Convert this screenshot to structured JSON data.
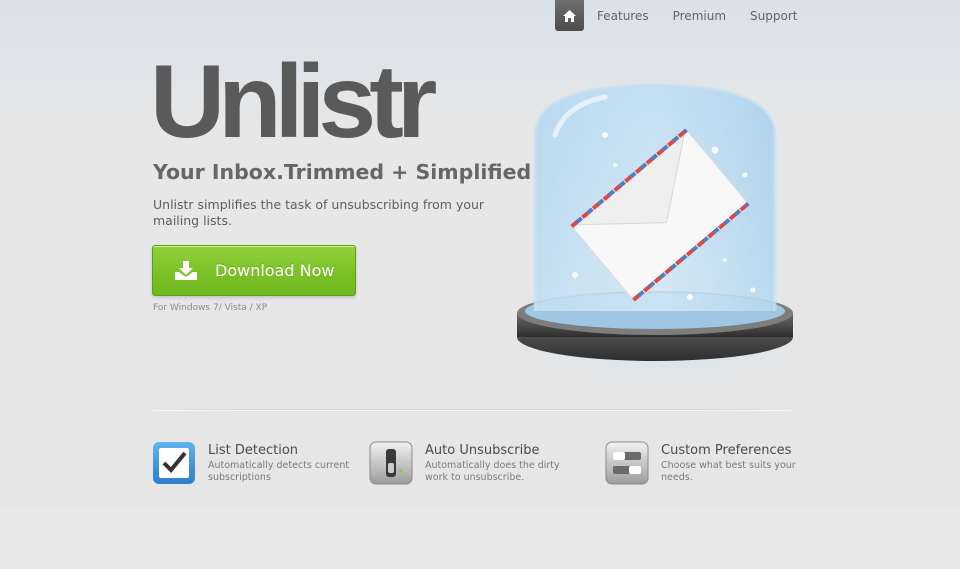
{
  "nav": {
    "home_icon": "home-icon",
    "links": [
      "Features",
      "Premium",
      "Support"
    ]
  },
  "hero": {
    "logo": "Unlistr",
    "tagline": "Your Inbox.Trimmed + Simplified",
    "description": "Unlistr simplifies the task of unsubscribing from your mailing lists.",
    "download_label": "Download Now",
    "download_icon": "download-tray-icon",
    "platform": "For Windows 7/ Vista / XP",
    "illustration": "envelope-in-glass-dome"
  },
  "features": [
    {
      "icon": "checkbox-icon",
      "title": "List Detection",
      "description": "Automatically detects current subscriptions"
    },
    {
      "icon": "switch-icon",
      "title": "Auto Unsubscribe",
      "description": "Automatically does the dirty work to unsubscribe."
    },
    {
      "icon": "preferences-icon",
      "title": "Custom Preferences",
      "description": "Choose what best suits your needs."
    }
  ],
  "colors": {
    "accent_green": "#7cc32a",
    "nav_home_bg": "#5a5a5a",
    "logo": "#5a5a5a",
    "background": "#e6e6e6"
  }
}
